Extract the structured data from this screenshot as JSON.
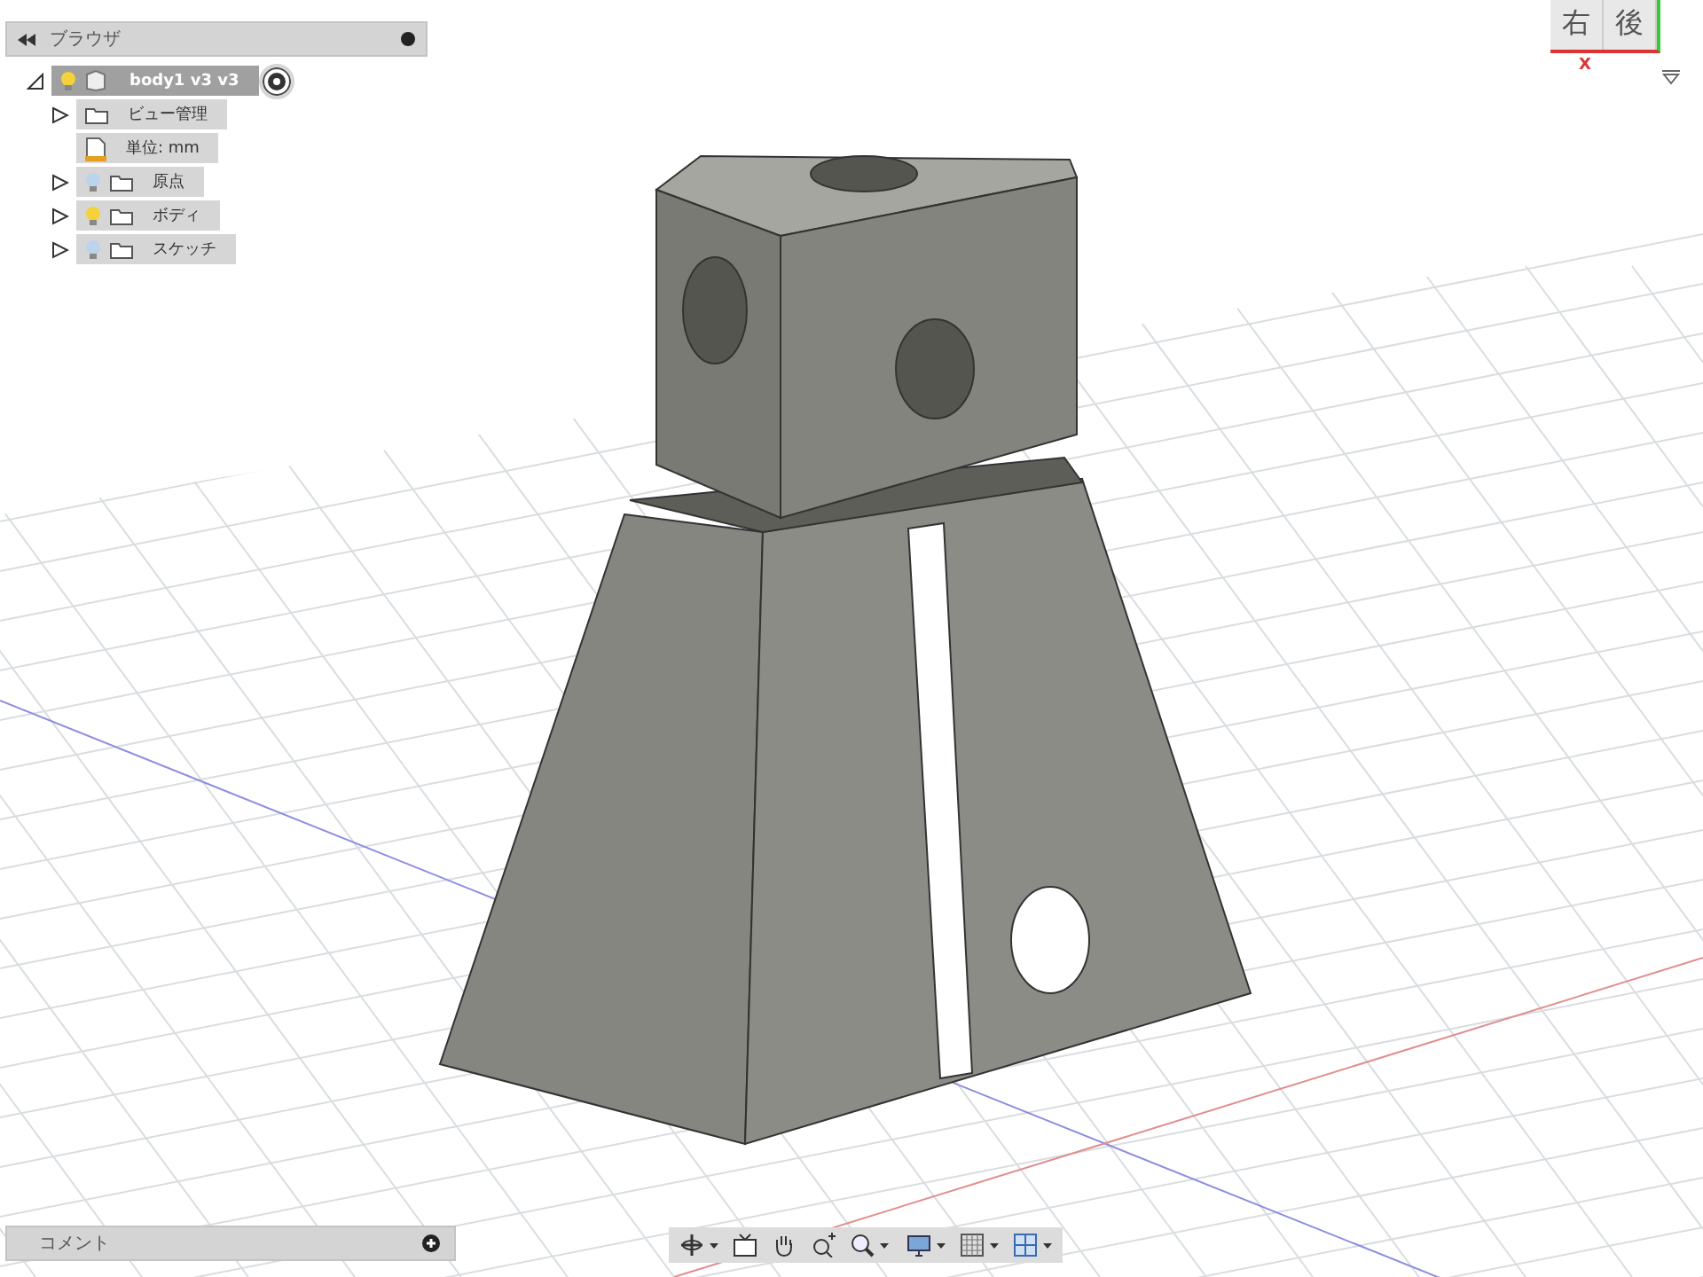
{
  "browser": {
    "title": "ブラウザ",
    "tree": [
      {
        "label": "body1 v3 v3",
        "kind": "component",
        "selected": true,
        "visible": true,
        "expanded": true,
        "children": [
          {
            "label": "ビュー管理",
            "kind": "folder",
            "selected": false,
            "expanded": false
          },
          {
            "label": "単位: mm",
            "kind": "units",
            "selected": false
          },
          {
            "label": "原点",
            "kind": "folder",
            "selected": false,
            "visible": false,
            "expanded": false
          },
          {
            "label": "ボディ",
            "kind": "folder",
            "selected": false,
            "visible": true,
            "expanded": false
          },
          {
            "label": "スケッチ",
            "kind": "folder",
            "selected": false,
            "visible": false,
            "expanded": false
          }
        ]
      }
    ]
  },
  "view_cube": {
    "faces": [
      "右",
      "後"
    ],
    "axis_label": "X"
  },
  "comments": {
    "title": "コメント"
  },
  "toolbar": {
    "groups": [
      [
        {
          "kind": "orbit",
          "dropdown": true
        },
        {
          "kind": "look",
          "dropdown": false
        },
        {
          "kind": "pan",
          "dropdown": false
        },
        {
          "kind": "zoom",
          "dropdown": false
        },
        {
          "kind": "fit",
          "dropdown": true
        }
      ],
      [
        {
          "kind": "display",
          "dropdown": true
        },
        {
          "kind": "grid",
          "dropdown": true
        },
        {
          "kind": "viewports",
          "dropdown": true
        }
      ]
    ]
  }
}
